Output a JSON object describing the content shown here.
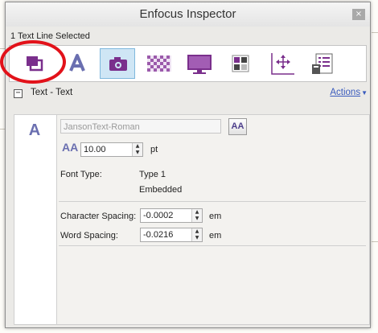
{
  "window": {
    "title": "Enfocus Inspector",
    "close_glyph": "×"
  },
  "selection_label": "1 Text Line Selected",
  "toolbar": {
    "active_index": 2,
    "tools": [
      {
        "icon": "object-layers-icon"
      },
      {
        "icon": "text-icon"
      },
      {
        "icon": "camera-icon"
      },
      {
        "icon": "transparency-icon"
      },
      {
        "icon": "monitor-icon"
      },
      {
        "icon": "color-swatches-icon"
      },
      {
        "icon": "position-axes-icon"
      },
      {
        "icon": "document-list-icon"
      }
    ]
  },
  "section": {
    "collapse_glyph": "−",
    "title": "Text - Text",
    "actions_label": "Actions",
    "actions_arrow": "▼"
  },
  "panel": {
    "left_icon_glyph": "A",
    "font_name": "JansonText-Roman",
    "font_button_glyph": "AA",
    "size_icon_glyph": "AA",
    "font_size": "10.00",
    "font_size_unit": "pt",
    "font_type_label": "Font Type:",
    "font_type_value": "Type 1",
    "font_embedded": "Embedded",
    "char_spacing_label": "Character Spacing:",
    "char_spacing_value": "-0.0002",
    "char_spacing_unit": "em",
    "word_spacing_label": "Word Spacing:",
    "word_spacing_value": "-0.0216",
    "word_spacing_unit": "em"
  },
  "colors": {
    "accent_purple": "#7a2f8c",
    "highlight_blue": "#cfe6f5",
    "annotation_red": "#e2121a",
    "link_blue": "#3a5bbd"
  }
}
